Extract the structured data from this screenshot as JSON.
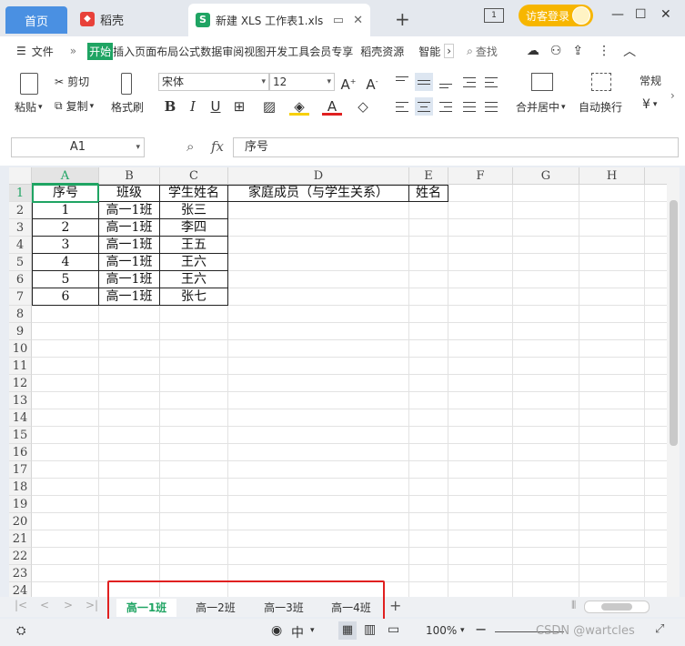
{
  "tabs": {
    "home": "首页",
    "daoke": "稻壳",
    "file": "新建 XLS 工作表1.xls",
    "new_tab": "+"
  },
  "titlebar": {
    "login": "访客登录"
  },
  "menu": {
    "file": "文件",
    "more": "»",
    "items": [
      "开始",
      "插入",
      "页面布局",
      "公式",
      "数据",
      "审阅",
      "视图",
      "开发工具",
      "会员专享",
      "稻壳资源",
      "智能"
    ],
    "search": "查找"
  },
  "ribbon": {
    "paste": "粘贴",
    "cut": "剪切",
    "copy": "复制",
    "format_painter": "格式刷",
    "font_name": "宋体",
    "font_size": "12",
    "bold": "B",
    "italic": "I",
    "underline": "U",
    "merge_center": "合并居中",
    "wrap_text": "自动换行",
    "number_format": "常规",
    "currency": "¥"
  },
  "formula_bar": {
    "cell_ref": "A1",
    "fx": "fx",
    "content": "序号"
  },
  "grid": {
    "columns": [
      "A",
      "B",
      "C",
      "D",
      "E",
      "F",
      "G",
      "H"
    ],
    "rows": [
      "1",
      "2",
      "3",
      "4",
      "5",
      "6",
      "7",
      "8",
      "9",
      "10",
      "11",
      "12",
      "13",
      "14",
      "15",
      "16",
      "17",
      "18",
      "19",
      "20",
      "21",
      "22",
      "23",
      "24"
    ],
    "header_row": [
      "序号",
      "班级",
      "学生姓名",
      "家庭成员（与学生关系）",
      "姓名"
    ],
    "data_rows": [
      [
        "1",
        "高一1班",
        "张三"
      ],
      [
        "2",
        "高一1班",
        "李四"
      ],
      [
        "3",
        "高一1班",
        "王五"
      ],
      [
        "4",
        "高一1班",
        "王六"
      ],
      [
        "5",
        "高一1班",
        "王六"
      ],
      [
        "6",
        "高一1班",
        "张七"
      ]
    ]
  },
  "sheets": [
    "高一1班",
    "高一2班",
    "高一3班",
    "高一4班"
  ],
  "sheet_add": "+",
  "status": {
    "zoom": "100%",
    "watermark": "CSDN @wartcles"
  },
  "colors": {
    "accent_green": "#1fa463",
    "home_tab": "#4a90e2",
    "login_btn": "#f7b600",
    "highlight_red": "#e02020"
  }
}
